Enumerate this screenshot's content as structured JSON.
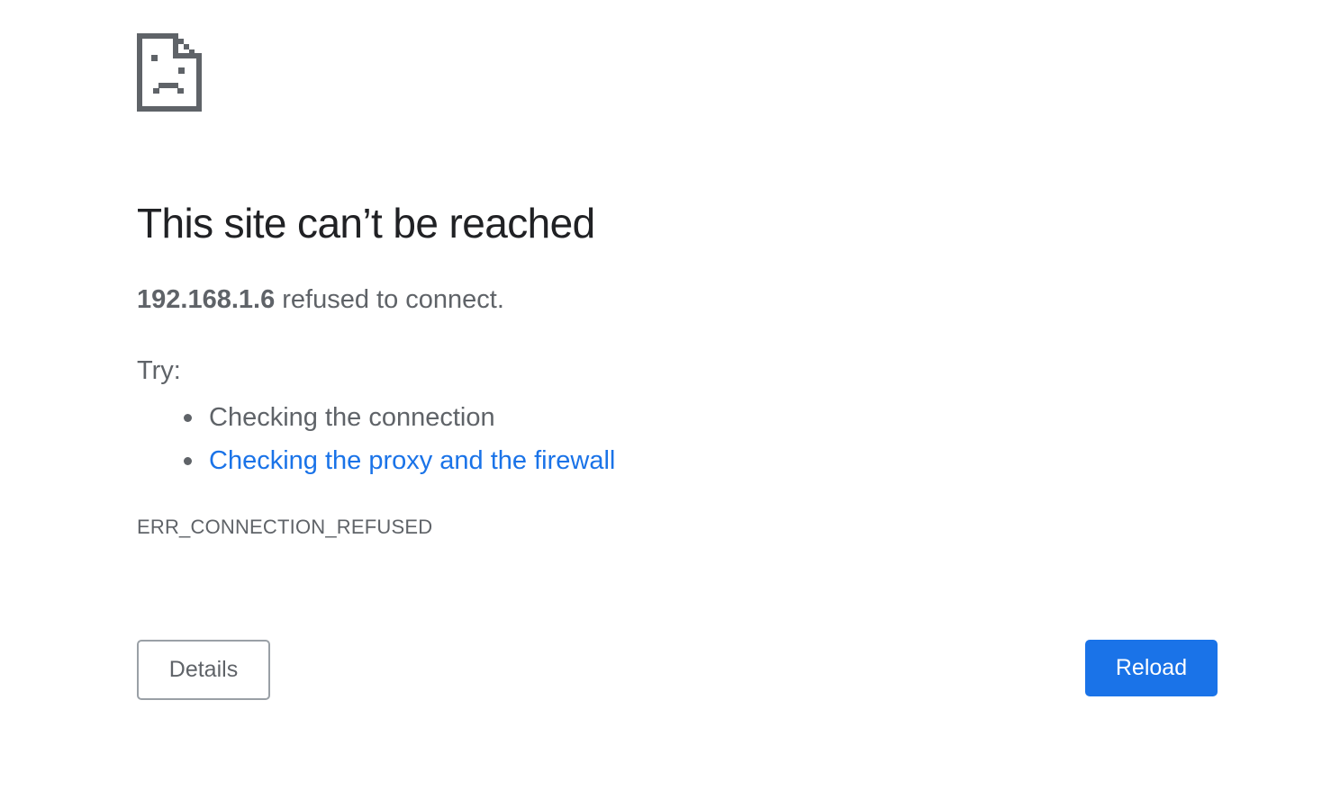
{
  "icon": {
    "name": "sad-page-icon"
  },
  "colors": {
    "title": "#202124",
    "text": "#5f6368",
    "link": "#1a73e8",
    "primary_button": "#1a73e8"
  },
  "error": {
    "title": "This site can’t be reached",
    "host": "192.168.1.6",
    "summary_suffix": " refused to connect.",
    "try_label": "Try:",
    "suggestions": [
      {
        "text": "Checking the connection",
        "is_link": false
      },
      {
        "text": "Checking the proxy and the firewall",
        "is_link": true
      }
    ],
    "code": "ERR_CONNECTION_REFUSED"
  },
  "buttons": {
    "details_label": "Details",
    "reload_label": "Reload"
  }
}
